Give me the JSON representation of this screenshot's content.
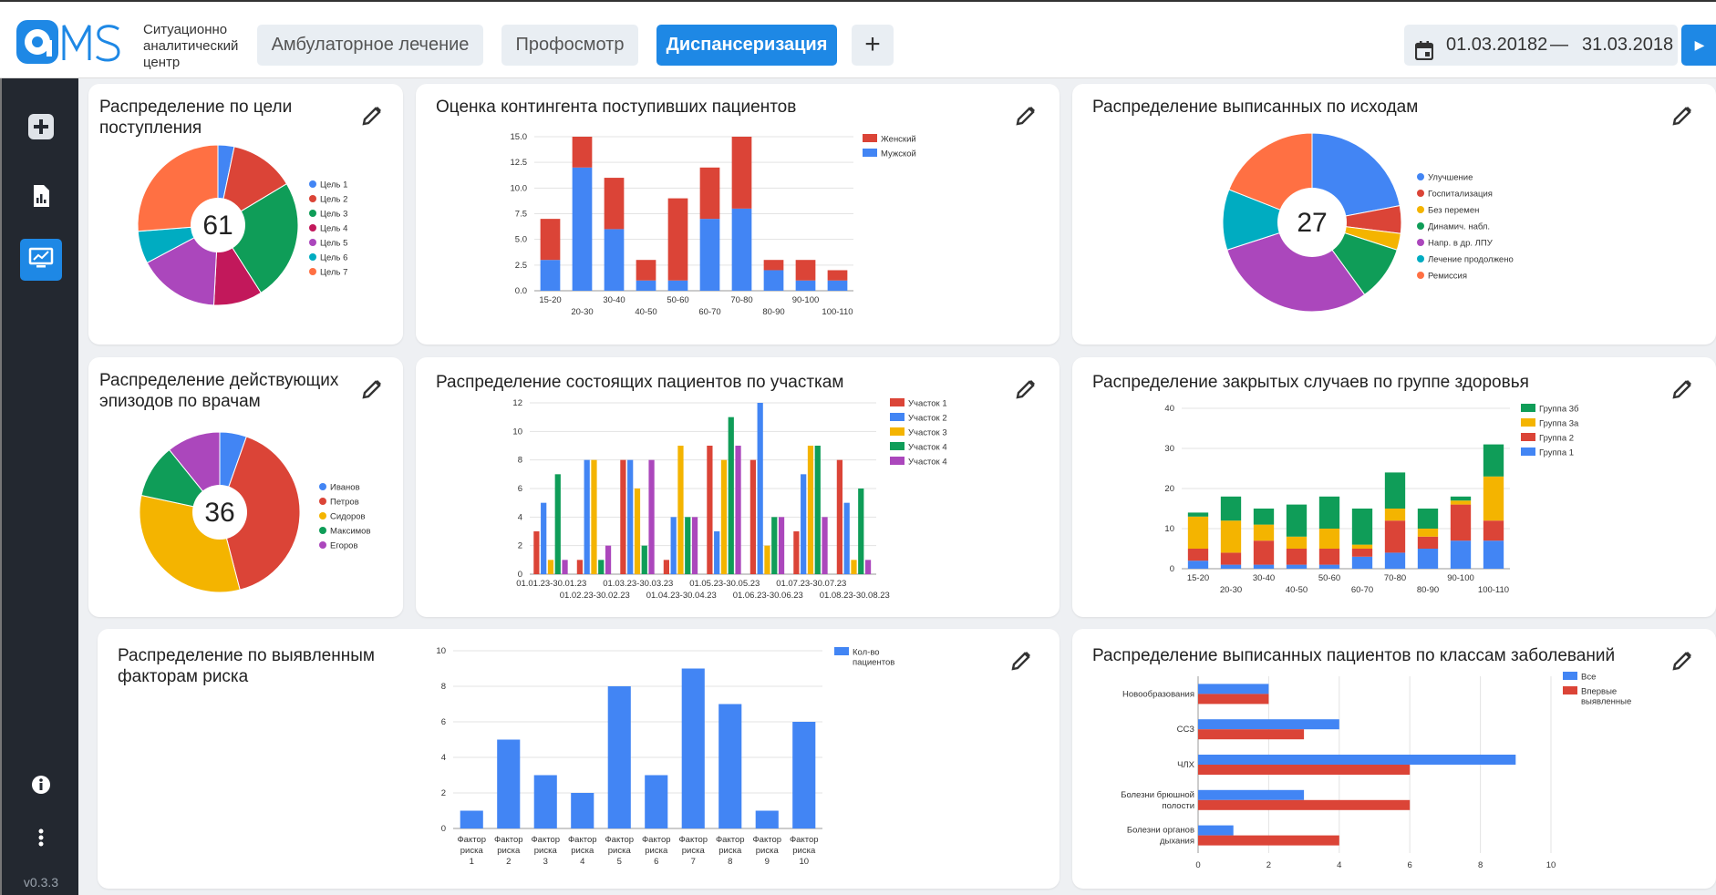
{
  "app": {
    "logo_text": "aMS",
    "brand": [
      "Ситуационно",
      "аналитический",
      "центр"
    ],
    "version": "v0.3.3"
  },
  "tabs": [
    {
      "label": "Амбулаторное лечение",
      "active": false
    },
    {
      "label": "Профосмотр",
      "active": false
    },
    {
      "label": "Диспансеризация",
      "active": true
    }
  ],
  "add_tab_label": "+",
  "date_range": {
    "from": "01.03.20182",
    "separator": "—",
    "to": "31.03.2018"
  },
  "sidebar_icons": [
    "add-icon",
    "report-icon",
    "dashboard-icon",
    "info-icon",
    "more-vertical-icon"
  ],
  "colors": {
    "accent": "#1e88e5",
    "sidebar": "#232830",
    "blue": "#4285f4",
    "red": "#db4437",
    "yellow": "#f4b400",
    "green": "#0f9d58",
    "purple": "#ab47bc",
    "teal": "#00acc1",
    "orange": "#ff7043",
    "crimson": "#c2185b"
  },
  "cards": {
    "c1": {
      "title": [
        "Распределение по цели",
        "поступления"
      ]
    },
    "c2": {
      "title": [
        "Оценка контингента поступивших пациентов"
      ]
    },
    "c3": {
      "title": [
        "Распределение выписанных по исходам"
      ]
    },
    "c4": {
      "title": [
        "Распределение действующих",
        "эпизодов по врачам"
      ]
    },
    "c5": {
      "title": [
        "Распределение состоящих пациентов по участкам"
      ]
    },
    "c6": {
      "title": [
        "Распределение закрытых случаев по группе здоровья"
      ]
    },
    "c7": {
      "title": [
        "Распределение по выявленным",
        "факторам риска"
      ]
    },
    "c8": {
      "title": [
        "Распределение выписанных пациентов по классам заболеваний"
      ]
    }
  },
  "chart_data": [
    {
      "id": "c1",
      "type": "pie",
      "donut": true,
      "center_label": "61",
      "labels": [
        "Цель 1",
        "Цель 2",
        "Цель 3",
        "Цель 4",
        "Цель 5",
        "Цель 6",
        "Цель 7"
      ],
      "values": [
        2,
        8,
        15,
        6,
        10,
        4,
        16
      ],
      "colors": [
        "#4285f4",
        "#db4437",
        "#0f9d58",
        "#c2185b",
        "#ab47bc",
        "#00acc1",
        "#ff7043"
      ],
      "legend": "right"
    },
    {
      "id": "c2",
      "type": "bar",
      "stacked": true,
      "categories": [
        "15-20",
        "20-30",
        "30-40",
        "40-50",
        "50-60",
        "60-70",
        "70-80",
        "80-90",
        "90-100",
        "100-110"
      ],
      "series": [
        {
          "name": "Мужской",
          "color": "#4285f4",
          "values": [
            3,
            12,
            6,
            1,
            1,
            7,
            8,
            2,
            1,
            1
          ]
        },
        {
          "name": "Женский",
          "color": "#db4437",
          "values": [
            4,
            3,
            5,
            2,
            8,
            5,
            7,
            1,
            2,
            1
          ]
        }
      ],
      "legend_order": [
        "Женский",
        "Мужской"
      ],
      "yticks": [
        "0.0",
        "2.5",
        "5.0",
        "7.5",
        "10.0",
        "12.5",
        "15.0"
      ],
      "ylim": [
        0,
        15
      ],
      "legend": "top-right",
      "grid": true
    },
    {
      "id": "c3",
      "type": "pie",
      "donut": true,
      "center_label": "27",
      "labels": [
        "Улучшение",
        "Госпитализация",
        "Без перемен",
        "Динамич. набл.",
        "Напр. в др. ЛПУ",
        "Лечение продолжено",
        "Ремиссия"
      ],
      "values": [
        22,
        5,
        3,
        10,
        30,
        11,
        19
      ],
      "colors": [
        "#4285f4",
        "#db4437",
        "#f4b400",
        "#0f9d58",
        "#ab47bc",
        "#00acc1",
        "#ff7043"
      ],
      "legend": "right"
    },
    {
      "id": "c4",
      "type": "pie",
      "donut": true,
      "center_label": "36",
      "labels": [
        "Иванов",
        "Петров",
        "Сидоров",
        "Максимов",
        "Егоров"
      ],
      "values": [
        2,
        15,
        12,
        4,
        4
      ],
      "colors": [
        "#4285f4",
        "#db4437",
        "#f4b400",
        "#0f9d58",
        "#ab47bc"
      ],
      "legend": "right"
    },
    {
      "id": "c5",
      "type": "bar",
      "stacked": false,
      "categories": [
        "01.01.23-30.01.23",
        "01.02.23-30.02.23",
        "01.03.23-30.03.23",
        "01.04.23-30.04.23",
        "01.05.23-30.05.23",
        "01.06.23-30.06.23",
        "01.07.23-30.07.23",
        "01.08.23-30.08.23"
      ],
      "series": [
        {
          "name": "Участок 1",
          "color": "#db4437",
          "values": [
            3,
            1,
            8,
            1,
            9,
            8,
            3,
            8
          ]
        },
        {
          "name": "Участок 2",
          "color": "#4285f4",
          "values": [
            5,
            8,
            8,
            4,
            3,
            12,
            7,
            5
          ]
        },
        {
          "name": "Участок 3",
          "color": "#f4b400",
          "values": [
            1,
            8,
            6,
            9,
            8,
            2,
            9,
            1
          ]
        },
        {
          "name": "Участок 4",
          "color": "#0f9d58",
          "values": [
            7,
            1,
            2,
            4,
            11,
            4,
            9,
            6
          ]
        },
        {
          "name": "Участок 4",
          "color": "#ab47bc",
          "values": [
            1,
            2,
            8,
            4,
            9,
            4,
            4,
            1
          ]
        }
      ],
      "yticks": [
        "0",
        "2",
        "4",
        "6",
        "8",
        "10",
        "12"
      ],
      "ylim": [
        0,
        12
      ],
      "legend": "top-right",
      "grid": true
    },
    {
      "id": "c6",
      "type": "bar",
      "stacked": true,
      "categories": [
        "15-20",
        "20-30",
        "30-40",
        "40-50",
        "50-60",
        "60-70",
        "70-80",
        "80-90",
        "90-100",
        "100-110"
      ],
      "series": [
        {
          "name": "Группа 1",
          "color": "#4285f4",
          "values": [
            2,
            1,
            1,
            1,
            1,
            3,
            4,
            5,
            7,
            7
          ]
        },
        {
          "name": "Группа 2",
          "color": "#db4437",
          "values": [
            3,
            3,
            6,
            4,
            4,
            2,
            8,
            3,
            9,
            5
          ]
        },
        {
          "name": "Группа 3а",
          "color": "#f4b400",
          "values": [
            8,
            8,
            4,
            3,
            5,
            1,
            3,
            2,
            1,
            11
          ]
        },
        {
          "name": "Группа 3б",
          "color": "#0f9d58",
          "values": [
            1,
            6,
            4,
            8,
            8,
            9,
            9,
            5,
            1,
            8
          ]
        }
      ],
      "legend_order": [
        "Группа 3б",
        "Группа 3а",
        "Группа 2",
        "Группа 1"
      ],
      "yticks": [
        "0",
        "10",
        "20",
        "30",
        "40"
      ],
      "ylim": [
        0,
        40
      ],
      "legend": "top-right",
      "grid": true
    },
    {
      "id": "c7",
      "type": "bar",
      "stacked": false,
      "categories": [
        [
          "Фактор",
          "риска",
          "1"
        ],
        [
          "Фактор",
          "риска",
          "2"
        ],
        [
          "Фактор",
          "риска",
          "3"
        ],
        [
          "Фактор",
          "риска",
          "4"
        ],
        [
          "Фактор",
          "риска",
          "5"
        ],
        [
          "Фактор",
          "риска",
          "6"
        ],
        [
          "Фактор",
          "риска",
          "7"
        ],
        [
          "Фактор",
          "риска",
          "8"
        ],
        [
          "Фактор",
          "риска",
          "9"
        ],
        [
          "Фактор",
          "риска",
          "10"
        ]
      ],
      "series": [
        {
          "name": "Кол-во пациентов",
          "name_lines": [
            "Кол-во",
            "пациентов"
          ],
          "color": "#4285f4",
          "values": [
            1,
            5,
            3,
            2,
            8,
            3,
            9,
            7,
            1,
            6
          ]
        }
      ],
      "yticks": [
        "0",
        "2",
        "4",
        "6",
        "8",
        "10"
      ],
      "ylim": [
        0,
        10
      ],
      "legend": "top-right",
      "grid": true
    },
    {
      "id": "c8",
      "type": "bar",
      "orientation": "horizontal",
      "categories": [
        [
          "Новообразования"
        ],
        [
          "ССЗ"
        ],
        [
          "ЧЛХ"
        ],
        [
          "Болезни брюшной",
          "полости"
        ],
        [
          "Болезни органов",
          "дыхания"
        ]
      ],
      "series": [
        {
          "name": "Все",
          "name_lines": [
            "Все"
          ],
          "color": "#4285f4",
          "values": [
            2,
            4,
            9,
            3,
            1
          ]
        },
        {
          "name": "Впервые выявленные",
          "name_lines": [
            "Впервые",
            "выявленные"
          ],
          "color": "#db4437",
          "values": [
            2,
            3,
            6,
            6,
            4
          ]
        }
      ],
      "xticks": [
        "0",
        "2",
        "4",
        "6",
        "8",
        "10"
      ],
      "xlim": [
        0,
        10
      ],
      "legend": "top-right",
      "grid": true
    }
  ]
}
